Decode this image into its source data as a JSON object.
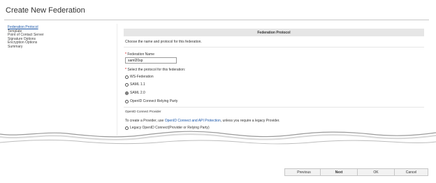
{
  "window": {
    "title": "Create New Federation"
  },
  "nav": {
    "items": [
      {
        "label": "Federation Protocol"
      },
      {
        "label": "Template"
      },
      {
        "label": "Point of Contact Server"
      },
      {
        "label": "Signature Options"
      },
      {
        "label": "Encryption Options"
      },
      {
        "label": "Summary"
      }
    ]
  },
  "main": {
    "section_title": "Federation Protocol",
    "description": "Choose the name and protocol for this federation.",
    "name_field": {
      "required_marker": "*",
      "label": "Federation Name",
      "value": "saml20sp"
    },
    "protocol": {
      "required_marker": "*",
      "label": "Select the protocol for this federation:",
      "options": [
        {
          "label": "WS-Federation",
          "checked": false
        },
        {
          "label": "SAML 1.1",
          "checked": false
        },
        {
          "label": "SAML 2.0",
          "checked": true
        },
        {
          "label": "OpenID Connect Relying Party",
          "checked": false
        }
      ]
    },
    "oidc": {
      "heading": "OpenID Connect Provider",
      "text_before": "To create a Provider, use ",
      "link": "OpenID Connect and API Protection",
      "text_after": ", unless you require a legacy Provider.",
      "legacy_option": {
        "label": "Legacy OpenID Connect(Provider or Relying Party)",
        "checked": false
      }
    }
  },
  "footer": {
    "previous": "Previous",
    "next": "Next",
    "ok": "OK",
    "cancel": "Cancel"
  }
}
